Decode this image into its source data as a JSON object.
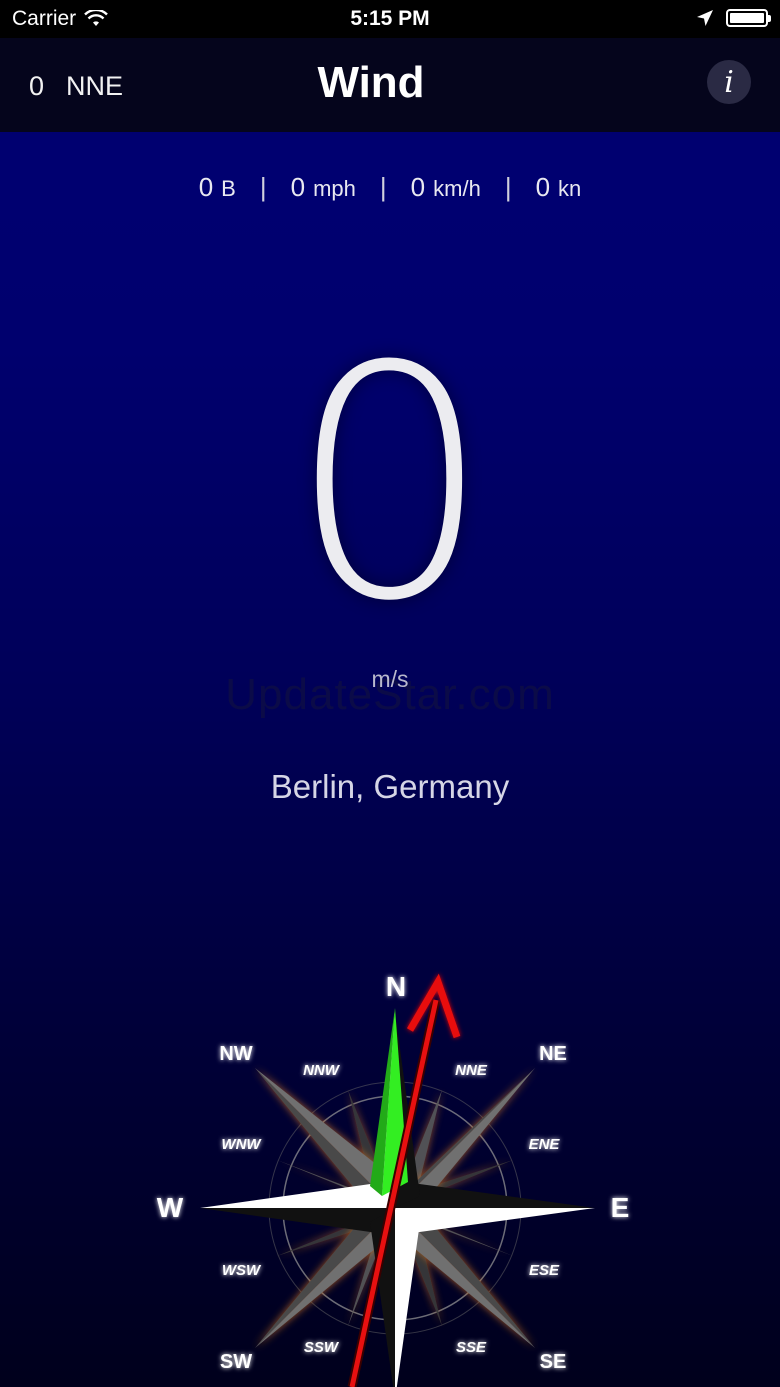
{
  "status_bar": {
    "carrier": "Carrier",
    "time": "5:15 PM"
  },
  "nav": {
    "speed": "0",
    "direction": "NNE",
    "title": "Wind",
    "info_label": "i"
  },
  "units": [
    {
      "value": "0",
      "unit": "B"
    },
    {
      "value": "0",
      "unit": "mph"
    },
    {
      "value": "0",
      "unit": "km/h"
    },
    {
      "value": "0",
      "unit": "kn"
    }
  ],
  "separator": "|",
  "main": {
    "value": "0",
    "unit": "m/s",
    "watermark": "UpdateStar.com",
    "location": "Berlin, Germany"
  },
  "compass": {
    "labels": [
      "N",
      "NE",
      "E",
      "SE",
      "SW",
      "W",
      "NW",
      "NNW",
      "NNE",
      "ENE",
      "ESE",
      "SSE",
      "SSW",
      "WSW",
      "WNW"
    ],
    "north_needle_color": "#33ee22",
    "wind_arrow_color": "#e81010"
  }
}
